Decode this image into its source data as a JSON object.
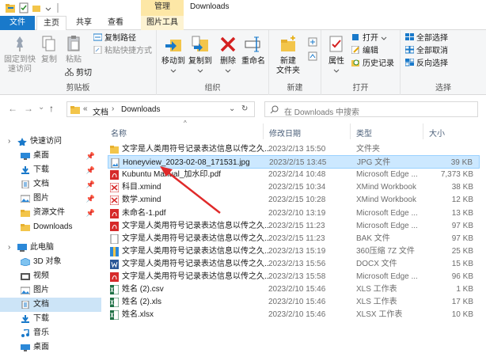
{
  "titlebar": {
    "manage": "管理",
    "title": "Downloads"
  },
  "tabs": {
    "file": "文件",
    "home": "主页",
    "share": "共享",
    "view": "查看",
    "picture_tools": "图片工具"
  },
  "ribbon": {
    "clipboard": {
      "pin_quick": "固定到快\n速访问",
      "copy": "复制",
      "paste": "粘贴",
      "copy_path": "复制路径",
      "paste_shortcut": "粘贴快捷方式",
      "cut": "剪切",
      "label": "剪贴板"
    },
    "organize": {
      "move_to": "移动到",
      "copy_to": "复制到",
      "delete": "删除",
      "rename": "重命名",
      "label": "组织"
    },
    "new": {
      "new_folder": "新建\n文件夹",
      "label": "新建"
    },
    "open": {
      "properties": "属性",
      "open": "打开",
      "edit": "编辑",
      "history": "历史记录",
      "label": "打开"
    },
    "select": {
      "select_all": "全部选择",
      "select_none": "全部取消",
      "invert": "反向选择",
      "label": "选择"
    }
  },
  "address": {
    "back": "←",
    "forward": "→",
    "dropdown": "⌄",
    "up": "↑",
    "crumb_sep": "«",
    "crumb1": "文档",
    "crumb_arrow": "›",
    "crumb2": "Downloads",
    "addr_dropdown": "⌄",
    "refresh": "↻",
    "search_placeholder": "在 Downloads 中搜索"
  },
  "nav": [
    {
      "label": "快速访问",
      "icon": "star-icon",
      "pinned": false
    },
    {
      "label": "桌面",
      "icon": "desktop-icon",
      "pinned": true
    },
    {
      "label": "下载",
      "icon": "download-icon",
      "pinned": true
    },
    {
      "label": "文档",
      "icon": "document-icon",
      "pinned": true
    },
    {
      "label": "图片",
      "icon": "picture-icon",
      "pinned": true
    },
    {
      "label": "资源文件",
      "icon": "folder-icon",
      "pinned": true
    },
    {
      "label": "Downloads",
      "icon": "folder-icon",
      "pinned": false
    },
    {
      "label": "此电脑",
      "icon": "computer-icon",
      "pinned": false
    },
    {
      "label": "3D 对象",
      "icon": "cube-icon",
      "pinned": false
    },
    {
      "label": "视频",
      "icon": "video-icon",
      "pinned": false
    },
    {
      "label": "图片",
      "icon": "picture-icon",
      "pinned": false
    },
    {
      "label": "文档",
      "icon": "document-icon",
      "pinned": false
    },
    {
      "label": "下载",
      "icon": "download-icon",
      "pinned": false
    },
    {
      "label": "音乐",
      "icon": "music-icon",
      "pinned": false
    },
    {
      "label": "桌面",
      "icon": "desktop-icon",
      "pinned": false
    }
  ],
  "pin_glyph": "📌",
  "columns": {
    "name": "名称",
    "date": "修改日期",
    "type": "类型",
    "size": "大小",
    "sort_glyph": "^"
  },
  "files": [
    {
      "name": "文字是人类用符号记录表达信息以传之久...",
      "date": "2023/2/13 15:50",
      "type": "文件夹",
      "size": "",
      "kind": "folder"
    },
    {
      "name": "Honeyview_2023-02-08_171531.jpg",
      "date": "2023/2/15 13:45",
      "type": "JPG 文件",
      "size": "39 KB",
      "kind": "jpg"
    },
    {
      "name": "Kubuntu Manual_加水印.pdf",
      "date": "2023/2/14 10:48",
      "type": "Microsoft Edge ...",
      "size": "7,373 KB",
      "kind": "pdf"
    },
    {
      "name": "科目.xmind",
      "date": "2023/2/15 10:34",
      "type": "XMind Workbook",
      "size": "38 KB",
      "kind": "xmind"
    },
    {
      "name": "数学.xmind",
      "date": "2023/2/15 10:28",
      "type": "XMind Workbook",
      "size": "12 KB",
      "kind": "xmind"
    },
    {
      "name": "未命名-1.pdf",
      "date": "2023/2/10 13:19",
      "type": "Microsoft Edge ...",
      "size": "13 KB",
      "kind": "pdf"
    },
    {
      "name": "文字是人类用符号记录表达信息以传之久...",
      "date": "2023/2/15 11:23",
      "type": "Microsoft Edge ...",
      "size": "97 KB",
      "kind": "pdf"
    },
    {
      "name": "文字是人类用符号记录表达信息以传之久...",
      "date": "2023/2/15 11:23",
      "type": "BAK 文件",
      "size": "97 KB",
      "kind": "blank"
    },
    {
      "name": "文字是人类用符号记录表达信息以传之久...",
      "date": "2023/2/13 15:19",
      "type": "360压缩 7Z 文件",
      "size": "25 KB",
      "kind": "zip"
    },
    {
      "name": "文字是人类用符号记录表达信息以传之久...",
      "date": "2023/2/13 15:56",
      "type": "DOCX 文件",
      "size": "15 KB",
      "kind": "docx"
    },
    {
      "name": "文字是人类用符号记录表达信息以传之久...",
      "date": "2023/2/13 15:58",
      "type": "Microsoft Edge ...",
      "size": "96 KB",
      "kind": "pdf"
    },
    {
      "name": "姓名 (2).csv",
      "date": "2023/2/10 15:46",
      "type": "XLS 工作表",
      "size": "1 KB",
      "kind": "xls"
    },
    {
      "name": "姓名 (2).xls",
      "date": "2023/2/10 15:46",
      "type": "XLS 工作表",
      "size": "17 KB",
      "kind": "xls"
    },
    {
      "name": "姓名.xlsx",
      "date": "2023/2/10 15:46",
      "type": "XLSX 工作表",
      "size": "10 KB",
      "kind": "xls"
    }
  ],
  "colors": {
    "accent": "#1979ca",
    "selection": "#cce8ff",
    "arrow": "#e02a2a",
    "folder": "#f3c54a"
  }
}
